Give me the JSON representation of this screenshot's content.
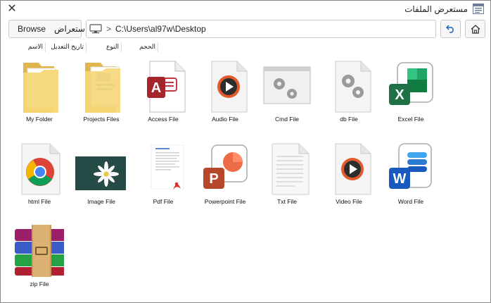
{
  "window": {
    "title": "مستعرض الملفات",
    "close_symbol": "✕"
  },
  "toolbar": {
    "browse_label_en": "Browse",
    "browse_label_ar": "استعراض",
    "address_separator": ">",
    "address_path": "C:\\Users\\al97w\\Desktop"
  },
  "columns": [
    "الاسم",
    "تاريخ التعديل",
    "النوع",
    "الحجم"
  ],
  "files": [
    {
      "label": "My Folder",
      "icon": "folder-icon"
    },
    {
      "label": "Projects Files",
      "icon": "folder-icon"
    },
    {
      "label": "Access File",
      "icon": "access-file-icon"
    },
    {
      "label": "Audio File",
      "icon": "audio-file-icon"
    },
    {
      "label": "Cmd File",
      "icon": "cmd-file-icon"
    },
    {
      "label": "db File",
      "icon": "db-file-icon"
    },
    {
      "label": "Excel File",
      "icon": "excel-file-icon"
    },
    {
      "label": "html File",
      "icon": "html-file-icon"
    },
    {
      "label": "Image File",
      "icon": "image-file-icon"
    },
    {
      "label": "Pdf File",
      "icon": "pdf-file-icon"
    },
    {
      "label": "Powerpoint File",
      "icon": "powerpoint-file-icon"
    },
    {
      "label": "Txt File",
      "icon": "txt-file-icon"
    },
    {
      "label": "Video File",
      "icon": "video-file-icon"
    },
    {
      "label": "Word File",
      "icon": "word-file-icon"
    },
    {
      "label": "zip File",
      "icon": "zip-file-icon"
    }
  ],
  "colors": {
    "folder": "#f3cf6a",
    "access": "#a4262c",
    "excel": "#1e7145",
    "powerpoint": "#c43e1c",
    "word": "#185abd",
    "pdf": "#d9302a",
    "media": "#e05a2b"
  }
}
